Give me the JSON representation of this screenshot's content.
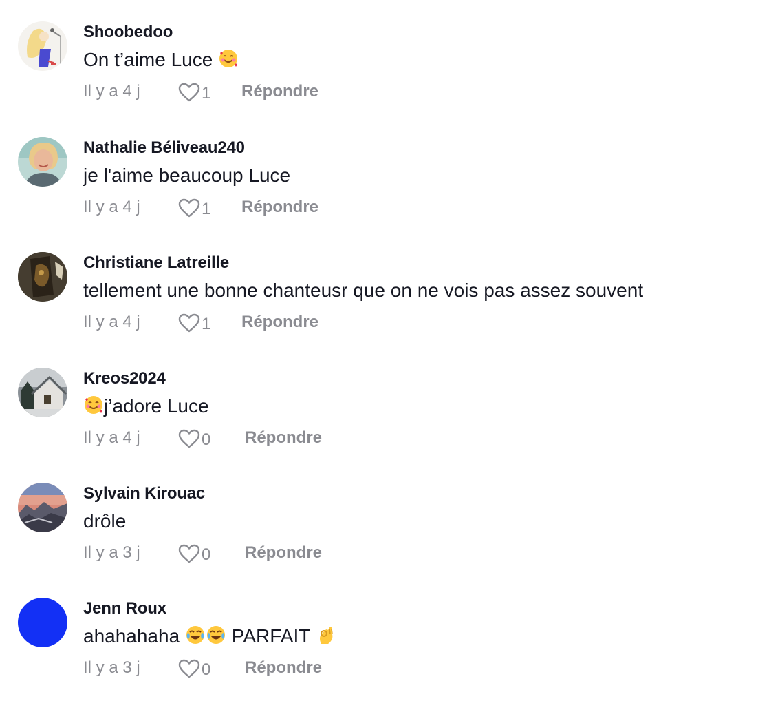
{
  "comments": [
    {
      "avatar": "woman-singer-drawing-avatar",
      "username": "Shoobedoo",
      "text_before": "On t’aime Luce ",
      "emoji_after": "smiling-face-with-hearts",
      "text_after": "",
      "time": "Il y a 4 j",
      "likes": "1",
      "reply": "Répondre"
    },
    {
      "avatar": "smiling-woman-photo-avatar",
      "username": "Nathalie Béliveau240",
      "text_before": "je l'aime beaucoup Luce",
      "emoji_after": "",
      "text_after": "",
      "time": "Il y a 4 j",
      "likes": "1",
      "reply": "Répondre"
    },
    {
      "avatar": "dark-sculpture-photo-avatar",
      "username": "Christiane Latreille",
      "text_before": "tellement une bonne chanteusr que on ne vois pas assez souvent",
      "emoji_after": "",
      "text_after": "",
      "time": "Il y a 4 j",
      "likes": "1",
      "reply": "Répondre"
    },
    {
      "avatar": "winter-house-photo-avatar",
      "username": "Kreos2024",
      "text_before": "",
      "emoji_before": "smiling-face-with-hearts",
      "text_after": "j’adore Luce",
      "time": "Il y a 4 j",
      "likes": "0",
      "reply": "Répondre"
    },
    {
      "avatar": "mountain-sunset-photo-avatar",
      "username": "Sylvain Kirouac",
      "text_before": "drôle",
      "emoji_after": "",
      "text_after": "",
      "time": "Il y a 3 j",
      "likes": "0",
      "reply": "Répondre"
    },
    {
      "avatar": "solid-blue-avatar",
      "username": "Jenn Roux",
      "text_before": "ahahahaha ",
      "emoji_after": "face-with-tears-of-joy x2",
      "text_after": " PARFAIT ",
      "emoji_end": "ok-hand",
      "time": "Il y a 3 j",
      "likes": "0",
      "reply": "Répondre"
    }
  ],
  "colors": {
    "text": "#161823",
    "muted": "#8a8b91",
    "blue_avatar": "#1330f5"
  },
  "icons": {
    "like": "heart-outline-icon"
  }
}
